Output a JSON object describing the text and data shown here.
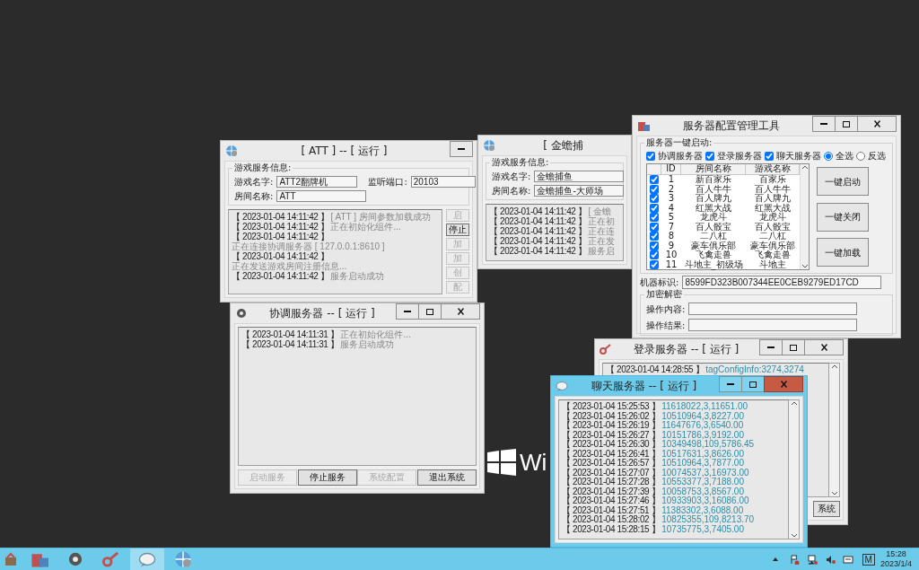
{
  "desktop": {
    "logo_text": "Wi"
  },
  "windows": [
    {
      "kind": "game",
      "title": "[ ATT ] -- [ 运行 ]",
      "active": false,
      "info": {
        "title": "游戏服务信息:",
        "rows": [
          [
            {
              "label": "游戏名字:",
              "value": "ATT2翻牌机"
            },
            {
              "label": "监听端口:",
              "value": "20103"
            }
          ],
          [
            {
              "label": "房间名称:",
              "value": "ATT"
            }
          ]
        ]
      },
      "log": [
        {
          "time": "【 2023-01-04 14:11:42 】",
          "message": "[ ATT ] 房间参数加载成功"
        },
        {
          "time": "【 2023-01-04 14:11:42 】",
          "message": "正在初始化组件..."
        },
        {
          "time": "【 2023-01-04 14:11:42 】",
          "message": "正在连接协调服务器 [ 127.0.0.1:8610 ]"
        },
        {
          "time": "【 2023-01-04 14:11:42 】",
          "message": "正在发送游戏房间注册信息..."
        },
        {
          "time": "【 2023-01-04 14:11:42 】",
          "message": "服务启动成功"
        }
      ],
      "buttons": [
        {
          "label": "启",
          "disabled": true
        },
        {
          "label": "停止",
          "disabled": false
        },
        {
          "label": "加",
          "disabled": true
        },
        {
          "label": "加",
          "disabled": true
        },
        {
          "label": "创",
          "disabled": true
        },
        {
          "label": "配",
          "disabled": true
        }
      ]
    },
    {
      "kind": "game",
      "title": "[ 金蟾捕",
      "active": false,
      "info": {
        "title": "游戏服务信息:",
        "rows": [
          [
            {
              "label": "游戏名字:",
              "value": "金蟾捕鱼"
            }
          ],
          [
            {
              "label": "房间名称:",
              "value": "金蟾捕鱼-大师场"
            }
          ]
        ]
      },
      "log": [
        {
          "time": "【 2023-01-04 14:11:42 】",
          "message": "[ 金蟾"
        },
        {
          "time": "【 2023-01-04 14:11:42 】",
          "message": "正在初"
        },
        {
          "time": "【 2023-01-04 14:11:42 】",
          "message": "正在连"
        },
        {
          "time": "【 2023-01-04 14:11:42 】",
          "message": "正在发"
        },
        {
          "time": "【 2023-01-04 14:11:42 】",
          "message": "服务启"
        }
      ]
    },
    {
      "kind": "config",
      "title": "服务器配置管理工具",
      "active": false,
      "launch": {
        "title": "服务器一键启动:",
        "servers": [
          {
            "label": "协调服务器",
            "checked": true
          },
          {
            "label": "登录服务器",
            "checked": true
          },
          {
            "label": "聊天服务器",
            "checked": true
          }
        ],
        "modes": [
          {
            "label": "全选",
            "selected": true
          },
          {
            "label": "反选",
            "selected": false
          }
        ],
        "columns": [
          "ID",
          "房间名称",
          "游戏名称"
        ],
        "rows": [
          {
            "checked": true,
            "id": "1",
            "room": "新百家乐",
            "game": "百家乐"
          },
          {
            "checked": true,
            "id": "2",
            "room": "百人牛牛",
            "game": "百人牛牛"
          },
          {
            "checked": true,
            "id": "3",
            "room": "百人牌九",
            "game": "百人牌九"
          },
          {
            "checked": true,
            "id": "4",
            "room": "红黑大战",
            "game": "红黑大战"
          },
          {
            "checked": true,
            "id": "5",
            "room": "龙虎斗",
            "game": "龙虎斗"
          },
          {
            "checked": true,
            "id": "7",
            "room": "百人骰宝",
            "game": "百人骰宝"
          },
          {
            "checked": true,
            "id": "8",
            "room": "二八杠",
            "game": "二八杠"
          },
          {
            "checked": true,
            "id": "9",
            "room": "豪车俱乐部",
            "game": "豪车俱乐部"
          },
          {
            "checked": true,
            "id": "10",
            "room": "飞禽走兽",
            "game": "飞禽走兽"
          },
          {
            "checked": true,
            "id": "11",
            "room": "斗地主_初级场",
            "game": "斗地主"
          }
        ],
        "buttons": [
          "一键启动",
          "一键关闭",
          "一键加载"
        ]
      },
      "machine": {
        "label": "机器标识:",
        "value": "8599FD323B007344EE0CEB9279ED17CD"
      },
      "crypto": {
        "title": "加密解密",
        "fields": [
          {
            "label": "操作内容:"
          },
          {
            "label": "操作结果:"
          }
        ]
      }
    },
    {
      "kind": "log",
      "title": "协调服务器 -- [ 运行 ]",
      "active": false,
      "log": [
        {
          "time": "【 2023-01-04 14:11:31 】",
          "message": "正在初始化组件..."
        },
        {
          "time": "【 2023-01-04 14:11:31 】",
          "message": "服务启动成功"
        }
      ],
      "buttons": [
        {
          "label": "启动服务",
          "disabled": true
        },
        {
          "label": "停止服务",
          "disabled": false
        },
        {
          "label": "系统配置",
          "disabled": true
        },
        {
          "label": "退出系统",
          "disabled": false
        }
      ]
    },
    {
      "kind": "data_log",
      "title": "登录服务器 -- [ 运行 ]",
      "active": false,
      "log": [
        {
          "time": "【 2023-01-04 14:28:55 】",
          "message": "tagConfigInfo:3274,3274"
        }
      ],
      "buttons": [
        {
          "label": "系统",
          "disabled": false
        }
      ]
    },
    {
      "kind": "data_log",
      "title": "聊天服务器 -- [ 运行 ]",
      "active": true,
      "log": [
        {
          "time": "【 2023-01-04 15:25:53 】",
          "message": "11618022,3,11651.00"
        },
        {
          "time": "【 2023-01-04 15:26:02 】",
          "message": "10510964,3,8227.00"
        },
        {
          "time": "【 2023-01-04 15:26:19 】",
          "message": "11647676,3,6540.00"
        },
        {
          "time": "【 2023-01-04 15:26:27 】",
          "message": "10151786,3,9192.00"
        },
        {
          "time": "【 2023-01-04 15:26:30 】",
          "message": "10349498,109,5786.45"
        },
        {
          "time": "【 2023-01-04 15:26:41 】",
          "message": "10517631,3,8626.00"
        },
        {
          "time": "【 2023-01-04 15:26:57 】",
          "message": "10510964,3,7877.00"
        },
        {
          "time": "【 2023-01-04 15:27:07 】",
          "message": "10074537,3,16973.00"
        },
        {
          "time": "【 2023-01-04 15:27:28 】",
          "message": "10553377,3,7188.00"
        },
        {
          "time": "【 2023-01-04 15:27:39 】",
          "message": "10058753,3,8567.00"
        },
        {
          "time": "【 2023-01-04 15:27:46 】",
          "message": "10933903,3,16086.00"
        },
        {
          "time": "【 2023-01-04 15:27:51 】",
          "message": "11383302,3,6088.00"
        },
        {
          "time": "【 2023-01-04 15:28:02 】",
          "message": "10825355,109,8213.70"
        },
        {
          "time": "【 2023-01-04 15:28:15 】",
          "message": "10735775,3,7405.00"
        }
      ]
    }
  ],
  "taskbar": {
    "apps": [
      {
        "selected": false
      },
      {
        "selected": false
      },
      {
        "selected": false
      },
      {
        "selected": true
      },
      {
        "selected": false
      }
    ],
    "ime": "M",
    "time": "15:28",
    "date": "2023/1/4"
  }
}
